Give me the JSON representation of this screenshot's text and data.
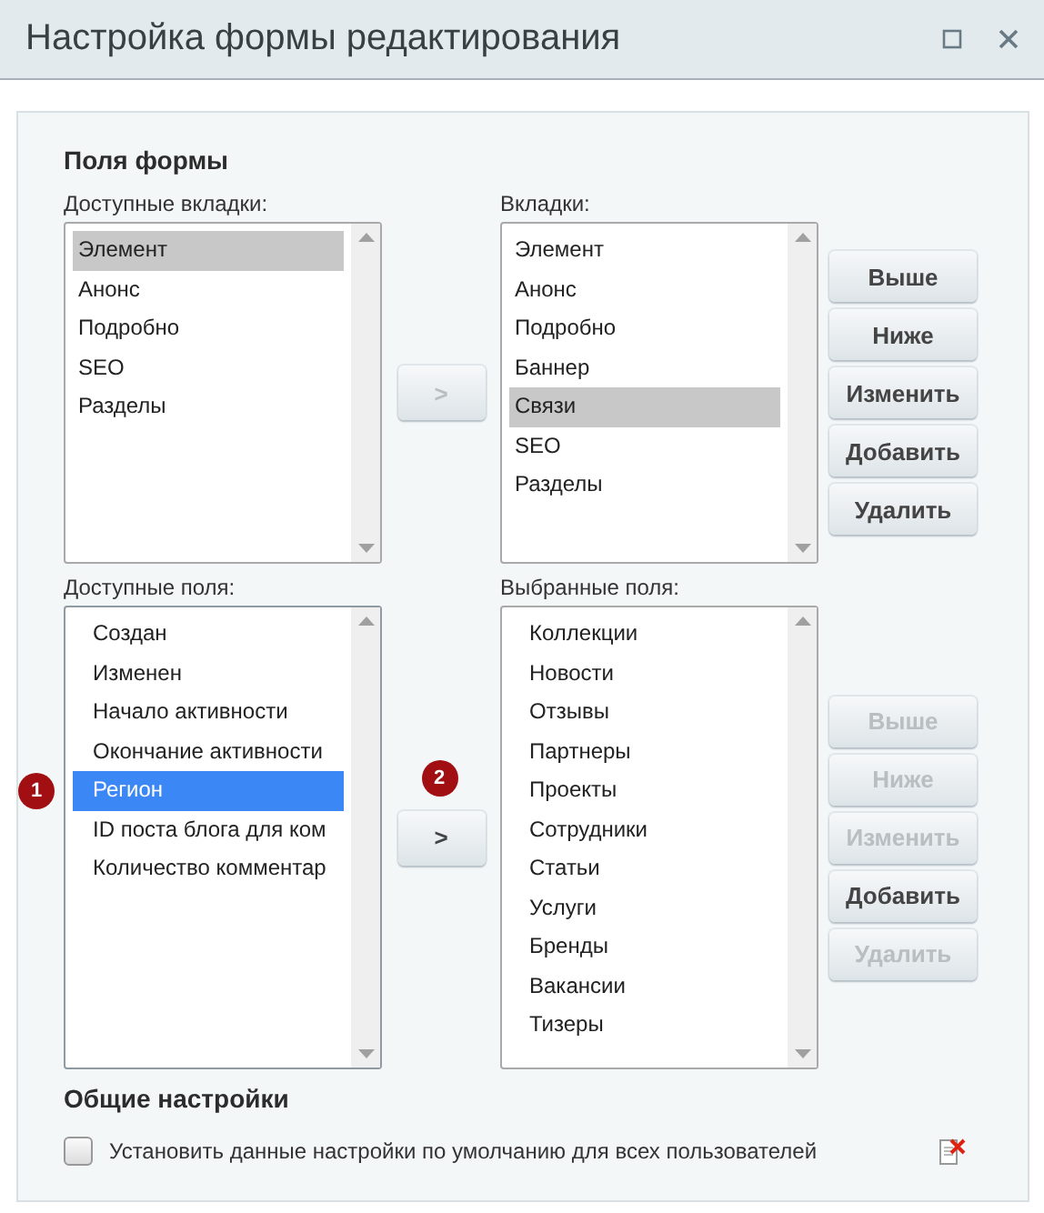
{
  "window": {
    "title": "Настройка формы редактирования"
  },
  "section_title": "Поля формы",
  "groups": [
    {
      "left": {
        "label": "Доступные вкладки:",
        "focused": false,
        "indented": false,
        "items": [
          {
            "label": "Элемент",
            "selected": true
          },
          {
            "label": "Анонс",
            "selected": false
          },
          {
            "label": "Подробно",
            "selected": false
          },
          {
            "label": "SEO",
            "selected": false
          },
          {
            "label": "Разделы",
            "selected": false
          }
        ]
      },
      "move_button": {
        "label": ">",
        "disabled": true
      },
      "right": {
        "label": "Вкладки:",
        "focused": false,
        "indented": false,
        "items": [
          {
            "label": "Элемент",
            "selected": false
          },
          {
            "label": "Анонс",
            "selected": false
          },
          {
            "label": "Подробно",
            "selected": false
          },
          {
            "label": "Баннер",
            "selected": false
          },
          {
            "label": "Связи",
            "selected": true
          },
          {
            "label": "SEO",
            "selected": false
          },
          {
            "label": "Разделы",
            "selected": false
          }
        ]
      },
      "buttons": [
        {
          "label": "Выше",
          "disabled": false
        },
        {
          "label": "Ниже",
          "disabled": false
        },
        {
          "label": "Изменить",
          "disabled": false
        },
        {
          "label": "Добавить",
          "disabled": false
        },
        {
          "label": "Удалить",
          "disabled": false
        }
      ]
    },
    {
      "left": {
        "label": "Доступные поля:",
        "focused": true,
        "indented": true,
        "items": [
          {
            "label": "Создан",
            "selected": false
          },
          {
            "label": "Изменен",
            "selected": false
          },
          {
            "label": "Начало активности",
            "selected": false
          },
          {
            "label": "Окончание активности",
            "selected": false
          },
          {
            "label": "Регион",
            "selected": true,
            "marker": "1"
          },
          {
            "label": "ID поста блога для ком",
            "selected": false
          },
          {
            "label": "Количество комментар",
            "selected": false
          }
        ]
      },
      "move_button": {
        "label": ">",
        "disabled": false,
        "marker": "2"
      },
      "right": {
        "label": "Выбранные поля:",
        "focused": false,
        "indented": true,
        "items": [
          {
            "label": "Коллекции",
            "selected": false
          },
          {
            "label": "Новости",
            "selected": false
          },
          {
            "label": "Отзывы",
            "selected": false
          },
          {
            "label": "Партнеры",
            "selected": false
          },
          {
            "label": "Проекты",
            "selected": false
          },
          {
            "label": "Сотрудники",
            "selected": false
          },
          {
            "label": "Статьи",
            "selected": false
          },
          {
            "label": "Услуги",
            "selected": false
          },
          {
            "label": "Бренды",
            "selected": false
          },
          {
            "label": "Вакансии",
            "selected": false
          },
          {
            "label": "Тизеры",
            "selected": false
          }
        ]
      },
      "buttons": [
        {
          "label": "Выше",
          "disabled": true
        },
        {
          "label": "Ниже",
          "disabled": true
        },
        {
          "label": "Изменить",
          "disabled": true
        },
        {
          "label": "Добавить",
          "disabled": false
        },
        {
          "label": "Удалить",
          "disabled": true
        }
      ]
    }
  ],
  "general": {
    "title": "Общие настройки",
    "checkbox": {
      "label": "Установить данные настройки по умолчанию для всех пользователей",
      "checked": false
    }
  }
}
